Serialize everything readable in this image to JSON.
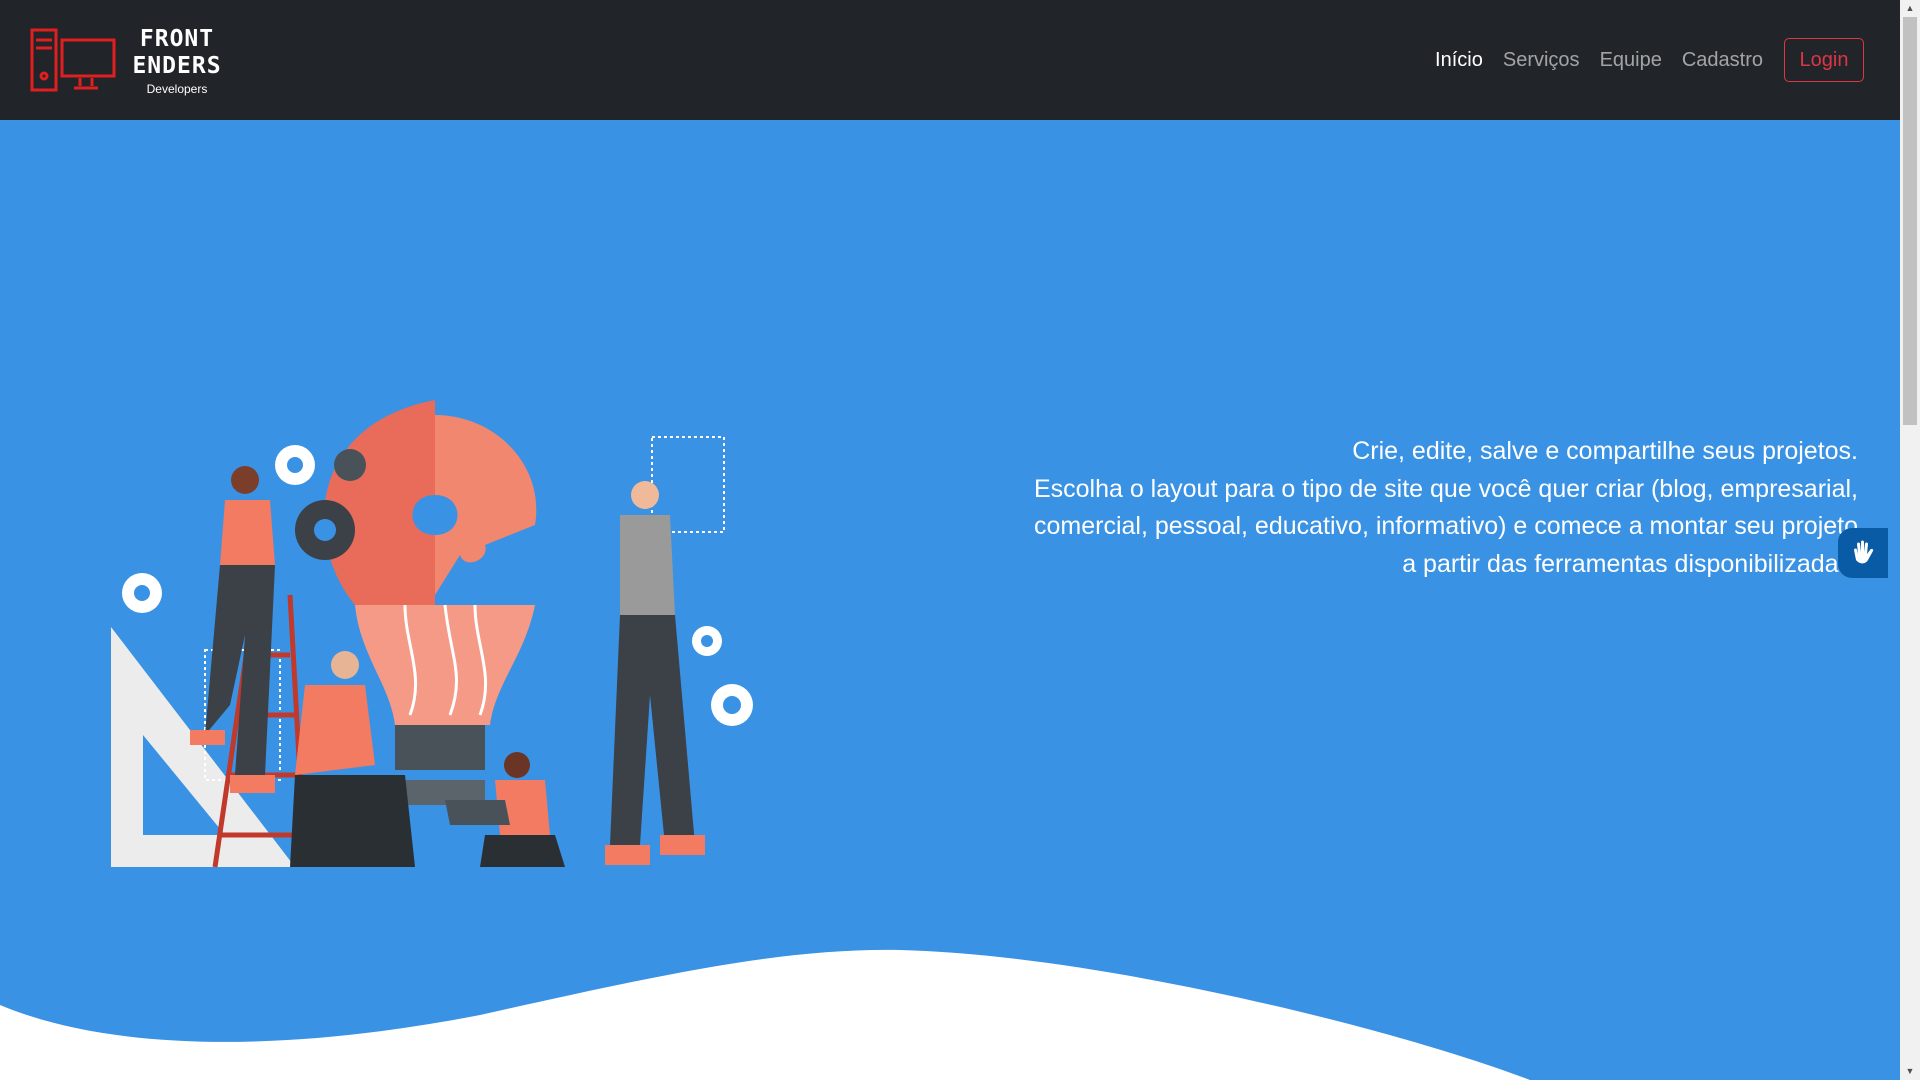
{
  "brand": {
    "line1": "FRONT",
    "line2": "ENDERS",
    "subtitle": "Developers",
    "accent_color": "#e02020"
  },
  "nav": {
    "items": [
      {
        "label": "Início",
        "active": true
      },
      {
        "label": "Serviços",
        "active": false
      },
      {
        "label": "Equipe",
        "active": false
      },
      {
        "label": "Cadastro",
        "active": false
      }
    ],
    "login_label": "Login"
  },
  "hero": {
    "lines": [
      "Crie, edite, salve e compartilhe seus projetos.",
      "Escolha o layout para o tipo de site que você quer criar (blog, empresarial,",
      "comercial, pessoal, educativo, informativo) e comece a montar seu projeto",
      "a partir das ferramentas disponibilizadas."
    ],
    "background_color": "#3a92e4",
    "illustration": "team-building-lightbulb-puzzle-illustration"
  },
  "accessibility_widget": {
    "icon": "sign-language-hand-icon"
  }
}
